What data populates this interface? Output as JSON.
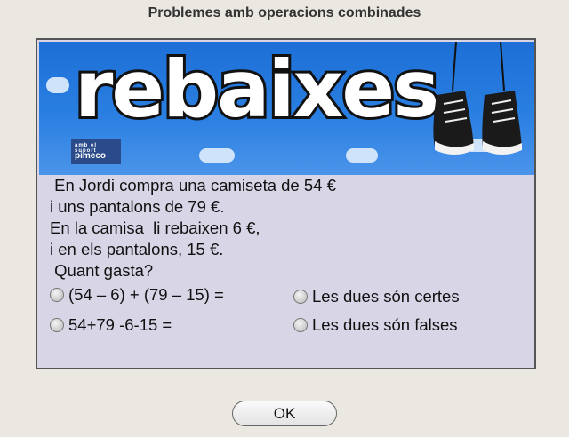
{
  "dialog": {
    "title": "Problemes amb operacions combinades"
  },
  "banner": {
    "word": "rebaixes",
    "logo_small": "amb el suport",
    "logo_main": "pimeco",
    "colors": {
      "sky": "#2a7fe2",
      "cloud": "#cfe3fb",
      "text_fill": "#ffffff",
      "outline": "#111111"
    }
  },
  "problem": {
    "lines": [
      " En Jordi compra una camiseta de 54 €",
      "i uns pantalons de 79 €.",
      "En la camisa  li rebaixen 6 €,",
      "i en els pantalons, 15 €.",
      " Quant gasta?"
    ]
  },
  "options": [
    {
      "label": "(54 – 6) + (79 – 15) ="
    },
    {
      "label": "54+79 -6-15 ="
    },
    {
      "label": "Les dues són certes"
    },
    {
      "label": "Les dues són falses"
    }
  ],
  "buttons": {
    "ok_label": "OK"
  }
}
